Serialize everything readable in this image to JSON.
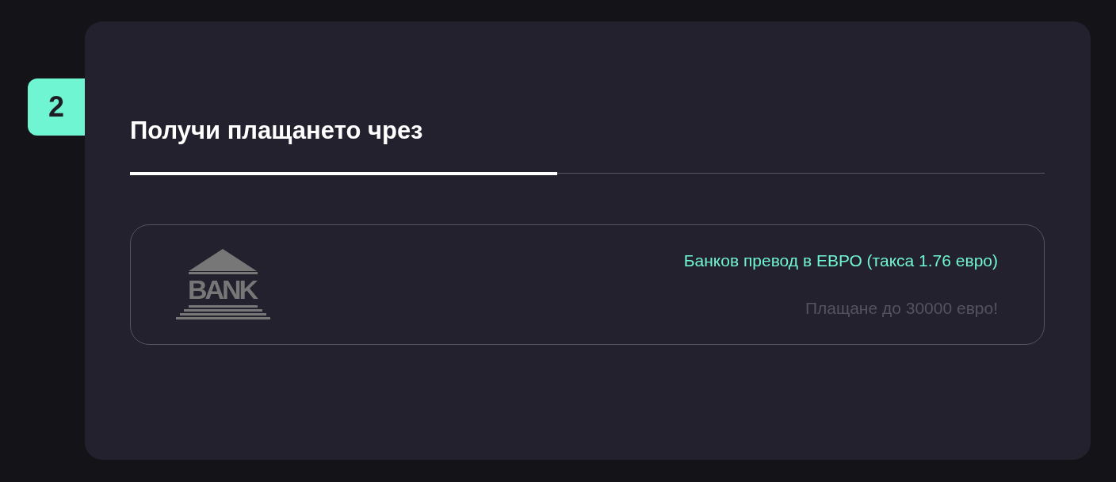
{
  "step": {
    "number": "2",
    "title": "Получи плащането чрез",
    "progress": {
      "level": 0.467
    }
  },
  "methods": [
    {
      "logo_text": "BANK",
      "name": "Банков превод в ЕВРО (такса 1.76 евро)",
      "limit": "Плащане до 30000 евро!",
      "selected": false
    }
  ]
}
